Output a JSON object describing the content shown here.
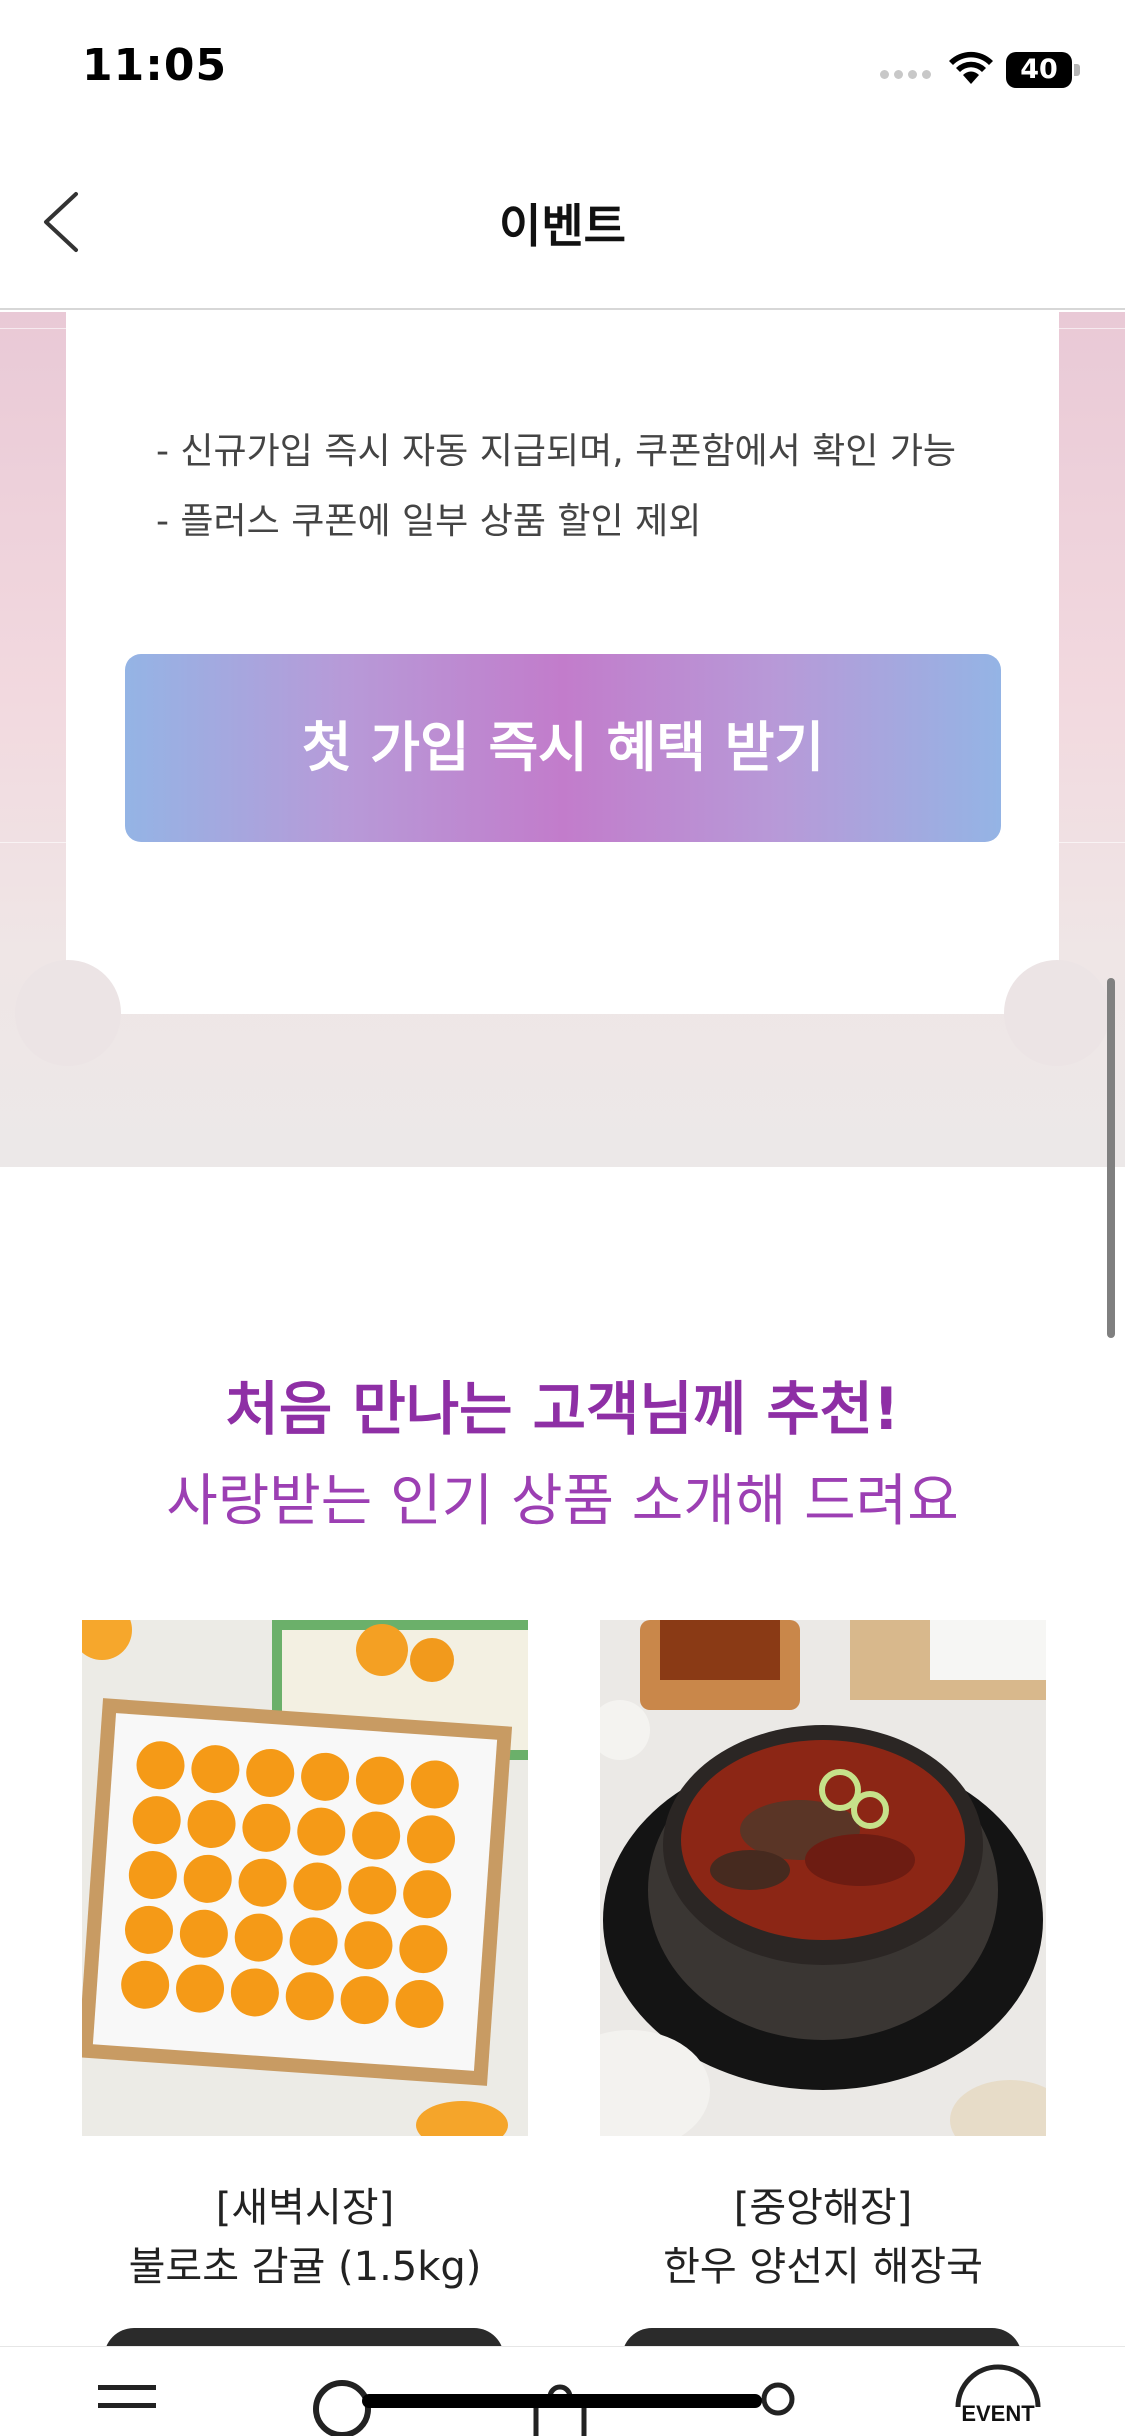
{
  "status_bar": {
    "time": "11:05",
    "battery": "40"
  },
  "header": {
    "title": "이벤트",
    "back_icon": "chevron-left-icon"
  },
  "coupon": {
    "notes": [
      "- 신규가입 즉시 자동 지급되며, 쿠폰함에서 확인 가능",
      "- 플러스 쿠폰에 일부 상품 할인 제외"
    ],
    "cta_label": "첫 가입 즉시 혜택 받기"
  },
  "recommendation": {
    "title": "처음 만나는 고객님께 추천!",
    "subtitle": "사랑받는 인기 상품 소개해 드려요",
    "products": [
      {
        "brand": "[새벽시장]",
        "name": "불로초 감귤 (1.5kg)",
        "image_icon": "tangerine-box-image"
      },
      {
        "brand": "[중앙해장]",
        "name": "한우 양선지 해장국",
        "image_icon": "hangover-soup-image"
      }
    ]
  },
  "tab_bar": {
    "items": [
      "menu-icon",
      "search-icon",
      "shopping-bag-icon",
      "profile-icon",
      "event-icon"
    ],
    "event_label": "EVENT"
  },
  "colors": {
    "accent_purple": "#8e2fa5",
    "cta_gradient_start": "#94b4e5",
    "cta_gradient_mid": "#c27ccb",
    "banner_pink": "#e9c9d6"
  }
}
